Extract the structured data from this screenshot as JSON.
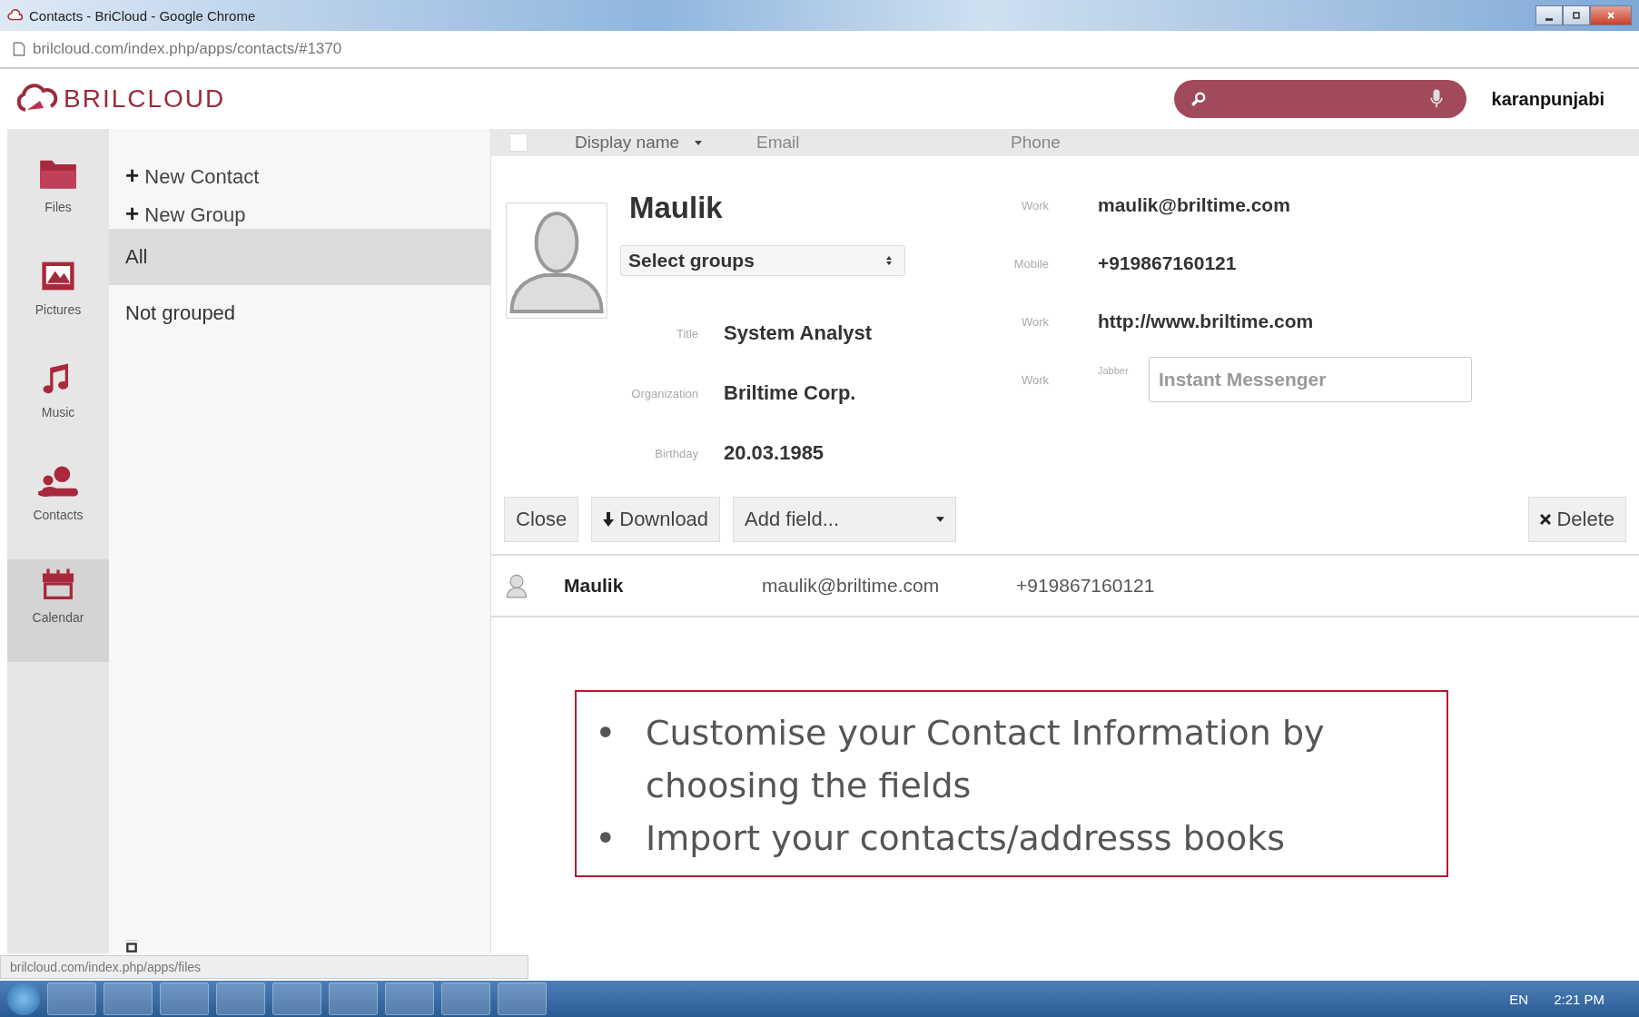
{
  "window": {
    "title": "Contacts - BriCloud - Google Chrome"
  },
  "address_bar": {
    "url": "brilcloud.com/index.php/apps/contacts/#1370"
  },
  "header": {
    "logo_text": "BRILCLOUD",
    "user": "karanpunjabi"
  },
  "app_nav": [
    {
      "label": "Files",
      "kind": "folder",
      "selected": false
    },
    {
      "label": "Pictures",
      "kind": "picture",
      "selected": false
    },
    {
      "label": "Music",
      "kind": "music",
      "selected": false
    },
    {
      "label": "Contacts",
      "kind": "people",
      "selected": false
    },
    {
      "label": "Calendar",
      "kind": "calendar",
      "selected": true
    }
  ],
  "groups_panel": {
    "actions": [
      {
        "icon": "+",
        "label": "New Contact"
      },
      {
        "icon": "+",
        "label": "New Group"
      }
    ],
    "groups": [
      {
        "label": "All",
        "selected": true
      },
      {
        "label": "Not grouped",
        "selected": false
      }
    ]
  },
  "table": {
    "select_all_checked": false,
    "columns": [
      "Display name",
      "Email",
      "Phone"
    ]
  },
  "contact": {
    "name": "Maulik",
    "groups_select": "Select groups",
    "fields": [
      {
        "label": "Title",
        "value": "System Analyst"
      },
      {
        "label": "Organization",
        "value": "Briltime Corp."
      },
      {
        "label": "Birthday",
        "value": "20.03.1985"
      }
    ],
    "details": [
      {
        "label": "Work",
        "kind": "text",
        "value": "maulik@briltime.com"
      },
      {
        "label": "Mobile",
        "kind": "text",
        "value": "+919867160121"
      },
      {
        "label": "Work",
        "kind": "text",
        "value": "http://www.briltime.com"
      },
      {
        "label": "Work",
        "kind": "im",
        "sublabel": "Jabber",
        "placeholder": "Instant Messenger"
      }
    ],
    "buttons": {
      "close": "Close",
      "download": "Download",
      "add_field": "Add field...",
      "delete": "Delete"
    }
  },
  "rows": [
    {
      "name": "Maulik",
      "email": "maulik@briltime.com",
      "phone": "+919867160121"
    }
  ],
  "annotation": {
    "items": [
      {
        "marker": "•",
        "text": "Customise your  Contact Information by choosing the fields"
      },
      {
        "marker": "•",
        "text": "Import your contacts/addresss books"
      }
    ]
  },
  "status_url": "brilcloud.com/index.php/apps/files",
  "taskbar": {
    "language": "EN",
    "time": "2:21 PM"
  }
}
